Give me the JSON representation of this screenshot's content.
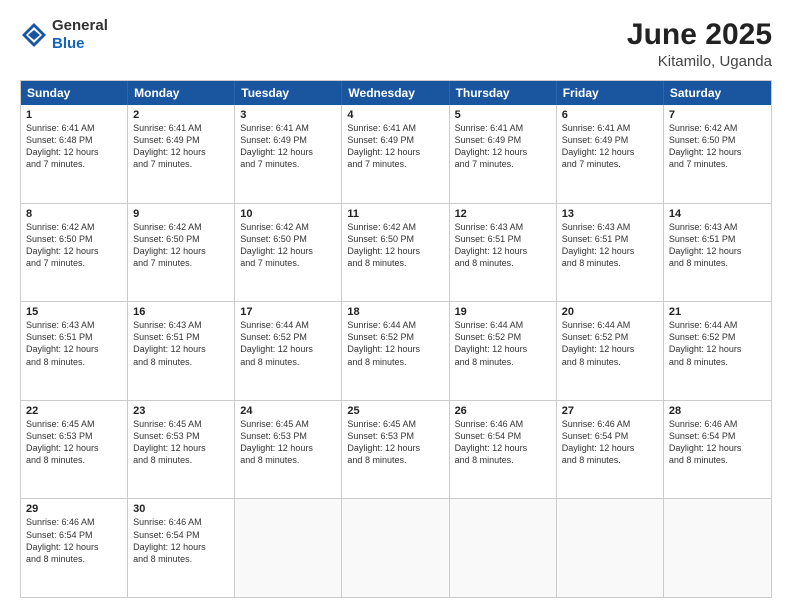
{
  "logo": {
    "general": "General",
    "blue": "Blue"
  },
  "title": "June 2025",
  "location": "Kitamilo, Uganda",
  "header_days": [
    "Sunday",
    "Monday",
    "Tuesday",
    "Wednesday",
    "Thursday",
    "Friday",
    "Saturday"
  ],
  "rows": [
    [
      {
        "day": "1",
        "lines": [
          "Sunrise: 6:41 AM",
          "Sunset: 6:48 PM",
          "Daylight: 12 hours",
          "and 7 minutes."
        ]
      },
      {
        "day": "2",
        "lines": [
          "Sunrise: 6:41 AM",
          "Sunset: 6:49 PM",
          "Daylight: 12 hours",
          "and 7 minutes."
        ]
      },
      {
        "day": "3",
        "lines": [
          "Sunrise: 6:41 AM",
          "Sunset: 6:49 PM",
          "Daylight: 12 hours",
          "and 7 minutes."
        ]
      },
      {
        "day": "4",
        "lines": [
          "Sunrise: 6:41 AM",
          "Sunset: 6:49 PM",
          "Daylight: 12 hours",
          "and 7 minutes."
        ]
      },
      {
        "day": "5",
        "lines": [
          "Sunrise: 6:41 AM",
          "Sunset: 6:49 PM",
          "Daylight: 12 hours",
          "and 7 minutes."
        ]
      },
      {
        "day": "6",
        "lines": [
          "Sunrise: 6:41 AM",
          "Sunset: 6:49 PM",
          "Daylight: 12 hours",
          "and 7 minutes."
        ]
      },
      {
        "day": "7",
        "lines": [
          "Sunrise: 6:42 AM",
          "Sunset: 6:50 PM",
          "Daylight: 12 hours",
          "and 7 minutes."
        ]
      }
    ],
    [
      {
        "day": "8",
        "lines": [
          "Sunrise: 6:42 AM",
          "Sunset: 6:50 PM",
          "Daylight: 12 hours",
          "and 7 minutes."
        ]
      },
      {
        "day": "9",
        "lines": [
          "Sunrise: 6:42 AM",
          "Sunset: 6:50 PM",
          "Daylight: 12 hours",
          "and 7 minutes."
        ]
      },
      {
        "day": "10",
        "lines": [
          "Sunrise: 6:42 AM",
          "Sunset: 6:50 PM",
          "Daylight: 12 hours",
          "and 7 minutes."
        ]
      },
      {
        "day": "11",
        "lines": [
          "Sunrise: 6:42 AM",
          "Sunset: 6:50 PM",
          "Daylight: 12 hours",
          "and 8 minutes."
        ]
      },
      {
        "day": "12",
        "lines": [
          "Sunrise: 6:43 AM",
          "Sunset: 6:51 PM",
          "Daylight: 12 hours",
          "and 8 minutes."
        ]
      },
      {
        "day": "13",
        "lines": [
          "Sunrise: 6:43 AM",
          "Sunset: 6:51 PM",
          "Daylight: 12 hours",
          "and 8 minutes."
        ]
      },
      {
        "day": "14",
        "lines": [
          "Sunrise: 6:43 AM",
          "Sunset: 6:51 PM",
          "Daylight: 12 hours",
          "and 8 minutes."
        ]
      }
    ],
    [
      {
        "day": "15",
        "lines": [
          "Sunrise: 6:43 AM",
          "Sunset: 6:51 PM",
          "Daylight: 12 hours",
          "and 8 minutes."
        ]
      },
      {
        "day": "16",
        "lines": [
          "Sunrise: 6:43 AM",
          "Sunset: 6:51 PM",
          "Daylight: 12 hours",
          "and 8 minutes."
        ]
      },
      {
        "day": "17",
        "lines": [
          "Sunrise: 6:44 AM",
          "Sunset: 6:52 PM",
          "Daylight: 12 hours",
          "and 8 minutes."
        ]
      },
      {
        "day": "18",
        "lines": [
          "Sunrise: 6:44 AM",
          "Sunset: 6:52 PM",
          "Daylight: 12 hours",
          "and 8 minutes."
        ]
      },
      {
        "day": "19",
        "lines": [
          "Sunrise: 6:44 AM",
          "Sunset: 6:52 PM",
          "Daylight: 12 hours",
          "and 8 minutes."
        ]
      },
      {
        "day": "20",
        "lines": [
          "Sunrise: 6:44 AM",
          "Sunset: 6:52 PM",
          "Daylight: 12 hours",
          "and 8 minutes."
        ]
      },
      {
        "day": "21",
        "lines": [
          "Sunrise: 6:44 AM",
          "Sunset: 6:52 PM",
          "Daylight: 12 hours",
          "and 8 minutes."
        ]
      }
    ],
    [
      {
        "day": "22",
        "lines": [
          "Sunrise: 6:45 AM",
          "Sunset: 6:53 PM",
          "Daylight: 12 hours",
          "and 8 minutes."
        ]
      },
      {
        "day": "23",
        "lines": [
          "Sunrise: 6:45 AM",
          "Sunset: 6:53 PM",
          "Daylight: 12 hours",
          "and 8 minutes."
        ]
      },
      {
        "day": "24",
        "lines": [
          "Sunrise: 6:45 AM",
          "Sunset: 6:53 PM",
          "Daylight: 12 hours",
          "and 8 minutes."
        ]
      },
      {
        "day": "25",
        "lines": [
          "Sunrise: 6:45 AM",
          "Sunset: 6:53 PM",
          "Daylight: 12 hours",
          "and 8 minutes."
        ]
      },
      {
        "day": "26",
        "lines": [
          "Sunrise: 6:46 AM",
          "Sunset: 6:54 PM",
          "Daylight: 12 hours",
          "and 8 minutes."
        ]
      },
      {
        "day": "27",
        "lines": [
          "Sunrise: 6:46 AM",
          "Sunset: 6:54 PM",
          "Daylight: 12 hours",
          "and 8 minutes."
        ]
      },
      {
        "day": "28",
        "lines": [
          "Sunrise: 6:46 AM",
          "Sunset: 6:54 PM",
          "Daylight: 12 hours",
          "and 8 minutes."
        ]
      }
    ],
    [
      {
        "day": "29",
        "lines": [
          "Sunrise: 6:46 AM",
          "Sunset: 6:54 PM",
          "Daylight: 12 hours",
          "and 8 minutes."
        ]
      },
      {
        "day": "30",
        "lines": [
          "Sunrise: 6:46 AM",
          "Sunset: 6:54 PM",
          "Daylight: 12 hours",
          "and 8 minutes."
        ]
      },
      {
        "day": "",
        "lines": []
      },
      {
        "day": "",
        "lines": []
      },
      {
        "day": "",
        "lines": []
      },
      {
        "day": "",
        "lines": []
      },
      {
        "day": "",
        "lines": []
      }
    ]
  ]
}
